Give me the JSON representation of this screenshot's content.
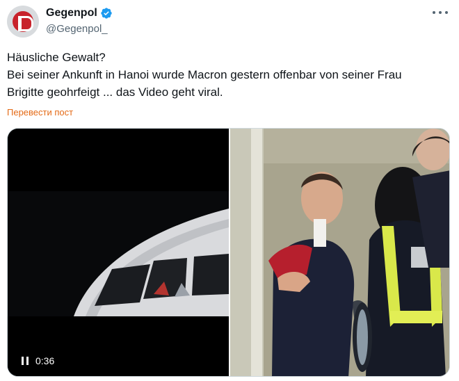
{
  "account": {
    "display_name": "Gegenpol",
    "handle": "@Gegenpol_",
    "verified": true,
    "brand_color": "#c8232c",
    "verified_color": "#1d9bf0"
  },
  "post": {
    "lines": [
      "Häusliche Gewalt?",
      "Bei seiner Ankunft in Hanoi wurde Macron gestern offenbar von seiner Frau",
      "Brigitte geohrfeigt ... das Video geht viral."
    ],
    "translate_label": "Перевести пост"
  },
  "media": {
    "video": {
      "duration": "0:36",
      "state": "playing",
      "control_icon": "pause-icon"
    },
    "photo": {
      "icon": "image"
    }
  },
  "icons": {
    "more": "more-horizontal-icon",
    "verified": "verified-badge-icon"
  }
}
